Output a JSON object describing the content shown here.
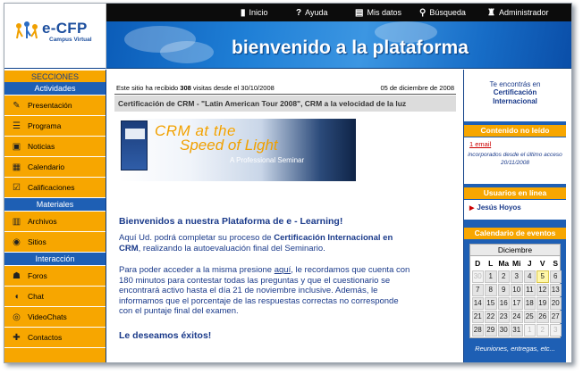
{
  "header": {
    "logo_title": "e-CFP",
    "logo_subtitle": "Campus Virtual",
    "banner_title": "bienvenido a la plataforma",
    "nav": [
      {
        "label": "Inicio",
        "icon": "home-icon"
      },
      {
        "label": "Ayuda",
        "icon": "help-icon"
      },
      {
        "label": "Mis datos",
        "icon": "my-data-icon"
      },
      {
        "label": "Búsqueda",
        "icon": "search-icon"
      },
      {
        "label": "Administrador",
        "icon": "admin-icon"
      }
    ]
  },
  "sidebar": {
    "title": "SECCIONES",
    "groups": [
      {
        "heading": "Actividades",
        "items": [
          {
            "label": "Presentación",
            "icon": "presentation-icon"
          },
          {
            "label": "Programa",
            "icon": "program-icon"
          },
          {
            "label": "Noticias",
            "icon": "news-icon"
          },
          {
            "label": "Calendario",
            "icon": "calendar-icon"
          },
          {
            "label": "Calificaciones",
            "icon": "grades-icon"
          }
        ]
      },
      {
        "heading": "Materiales",
        "items": [
          {
            "label": "Archivos",
            "icon": "files-icon"
          },
          {
            "label": "Sitios",
            "icon": "sites-icon"
          }
        ]
      },
      {
        "heading": "Interacción",
        "items": [
          {
            "label": "Foros",
            "icon": "forums-icon"
          },
          {
            "label": "Chat",
            "icon": "chat-icon"
          },
          {
            "label": "VideoChats",
            "icon": "videochat-icon"
          },
          {
            "label": "Contactos",
            "icon": "contacts-icon"
          }
        ]
      }
    ]
  },
  "main": {
    "visits_prefix": "Este sitio ha recibido",
    "visits_count": "308",
    "visits_suffix": "visitas desde el 30/10/2008",
    "date": "05 de diciembre de 2008",
    "subject": "Certificación de CRM - \"Latin American Tour 2008\", CRM a la velocidad de la luz",
    "seminar_title_1": "CRM at the",
    "seminar_title_2": "Speed of Light",
    "seminar_subtitle": "A Professional Seminar",
    "welcome": "Bienvenidos a nuestra Plataforma de e - Learning!",
    "p1_a": "Aquí Ud. podrá completar su proceso de",
    "p1_b": "Certificación Internacional en CRM",
    "p1_c": ", realizando la autoevaluación final del Seminario.",
    "p2_a": "Para poder acceder a la misma presione",
    "p2_link": "aquí",
    "p2_b": ", le recordamos que cuenta con 180 minutos para contestar todas las preguntas y que el cuestionario se encontrará activo hasta el día 21 de noviembre inclusive. Además, le informamos que el porcentaje de las respuestas correctas no corresponde con el puntaje final del examen.",
    "closing": "Le deseamos éxitos!"
  },
  "right": {
    "course_label": "Te encontrás en",
    "course_name_1": "Certificación",
    "course_name_2": "Internacional",
    "unread_heading": "Contenido no leído",
    "unread_link": "1 email",
    "unread_note": "incorporados desde el último acceso 20/11/2008",
    "online_heading": "Usuarios en línea",
    "online_user": "Jesús Hoyos",
    "events_heading": "Calendario de eventos",
    "calendar_month": "Diciembre",
    "calendar_dow": [
      "D",
      "L",
      "Ma",
      "Mi",
      "J",
      "V",
      "S"
    ],
    "calendar_weeks": [
      [
        "30",
        "1",
        "2",
        "3",
        "4",
        "5",
        "6"
      ],
      [
        "7",
        "8",
        "9",
        "10",
        "11",
        "12",
        "13"
      ],
      [
        "14",
        "15",
        "16",
        "17",
        "18",
        "19",
        "20"
      ],
      [
        "21",
        "22",
        "23",
        "24",
        "25",
        "26",
        "27"
      ],
      [
        "28",
        "29",
        "30",
        "31",
        "1",
        "2",
        "3"
      ]
    ],
    "calendar_today": "5",
    "calendar_footer": "Reuniones, entregas, etc..."
  },
  "colors": {
    "accent_orange": "#f7a600",
    "brand_blue": "#1e5fb4",
    "text_blue": "#1a3a8a",
    "alert_red": "#cc0000"
  }
}
